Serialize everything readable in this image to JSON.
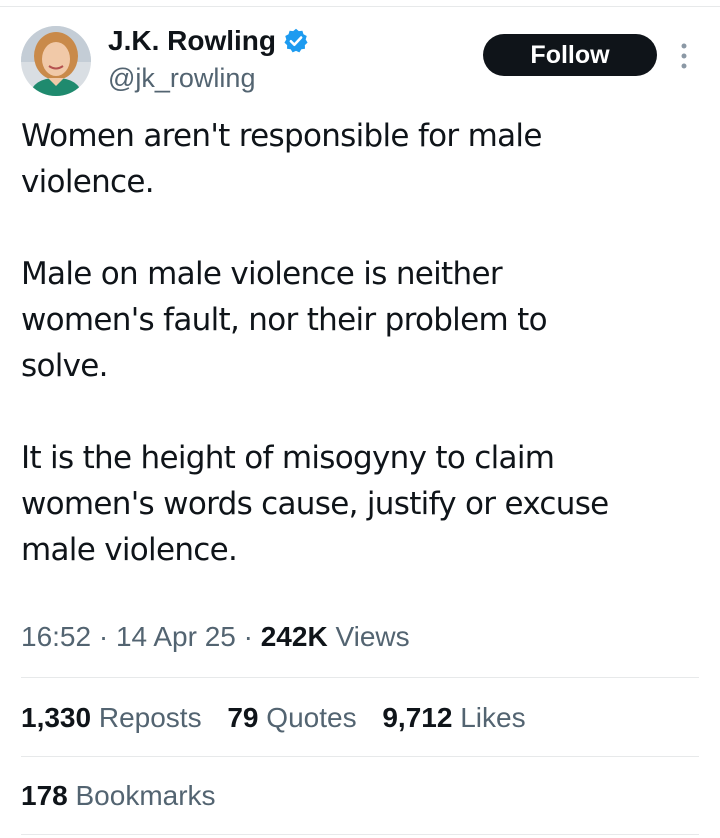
{
  "author": {
    "display_name": "J.K. Rowling",
    "handle": "@jk_rowling",
    "verified": true,
    "verified_color": "#1d9bf0"
  },
  "actions": {
    "follow_label": "Follow",
    "more_icon": "more-vertical-icon"
  },
  "tweet": {
    "paragraphs": [
      {
        "line1": "Women aren't responsible for male",
        "line2": "violence."
      },
      {
        "line1": "Male on male violence is neither",
        "line2": "women's fault, nor their problem to",
        "line3": "solve."
      },
      {
        "line1": "It is the height of misogyny to claim",
        "line2": "women's words cause, justify or excuse",
        "line3": "male violence."
      }
    ]
  },
  "meta": {
    "time": "16:52",
    "separator": "·",
    "date": "14 Apr 25",
    "views_count": "242K",
    "views_label": "Views"
  },
  "stats": {
    "reposts_count": "1,330",
    "reposts_label": "Reposts",
    "quotes_count": "79",
    "quotes_label": "Quotes",
    "likes_count": "9,712",
    "likes_label": "Likes",
    "bookmarks_count": "178",
    "bookmarks_label": "Bookmarks"
  },
  "colors": {
    "text_primary": "#0f1419",
    "text_secondary": "#536471",
    "divider": "#e7e9ea"
  }
}
